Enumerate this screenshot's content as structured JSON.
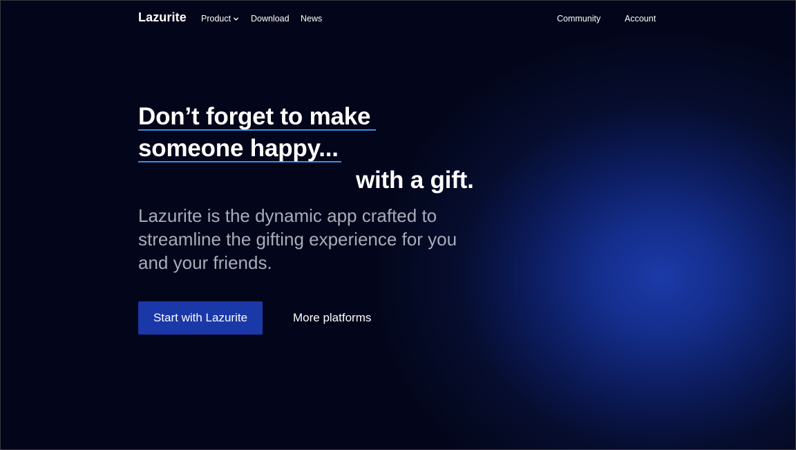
{
  "nav": {
    "brand": "Lazurite",
    "links": {
      "product": "Product",
      "download": "Download",
      "news": "News",
      "community": "Community",
      "account": "Account"
    },
    "product_icon": "chevron-down-icon"
  },
  "hero": {
    "headline_line1": "Don’t forget to make",
    "headline_line2": "someone happy...",
    "headline_line3": "with a gift.",
    "subtitle": "Lazurite is the dynamic app crafted to streamline the gifting experience for you and your friends.",
    "primary_cta": "Start with Lazurite",
    "secondary_cta": "More platforms"
  },
  "colors": {
    "background": "#03061a",
    "glow": "#1c3aa8",
    "underline_accent": "#3d8fe8",
    "primary_button": "#1a38a8",
    "subtitle_text": "#a9acb8"
  }
}
